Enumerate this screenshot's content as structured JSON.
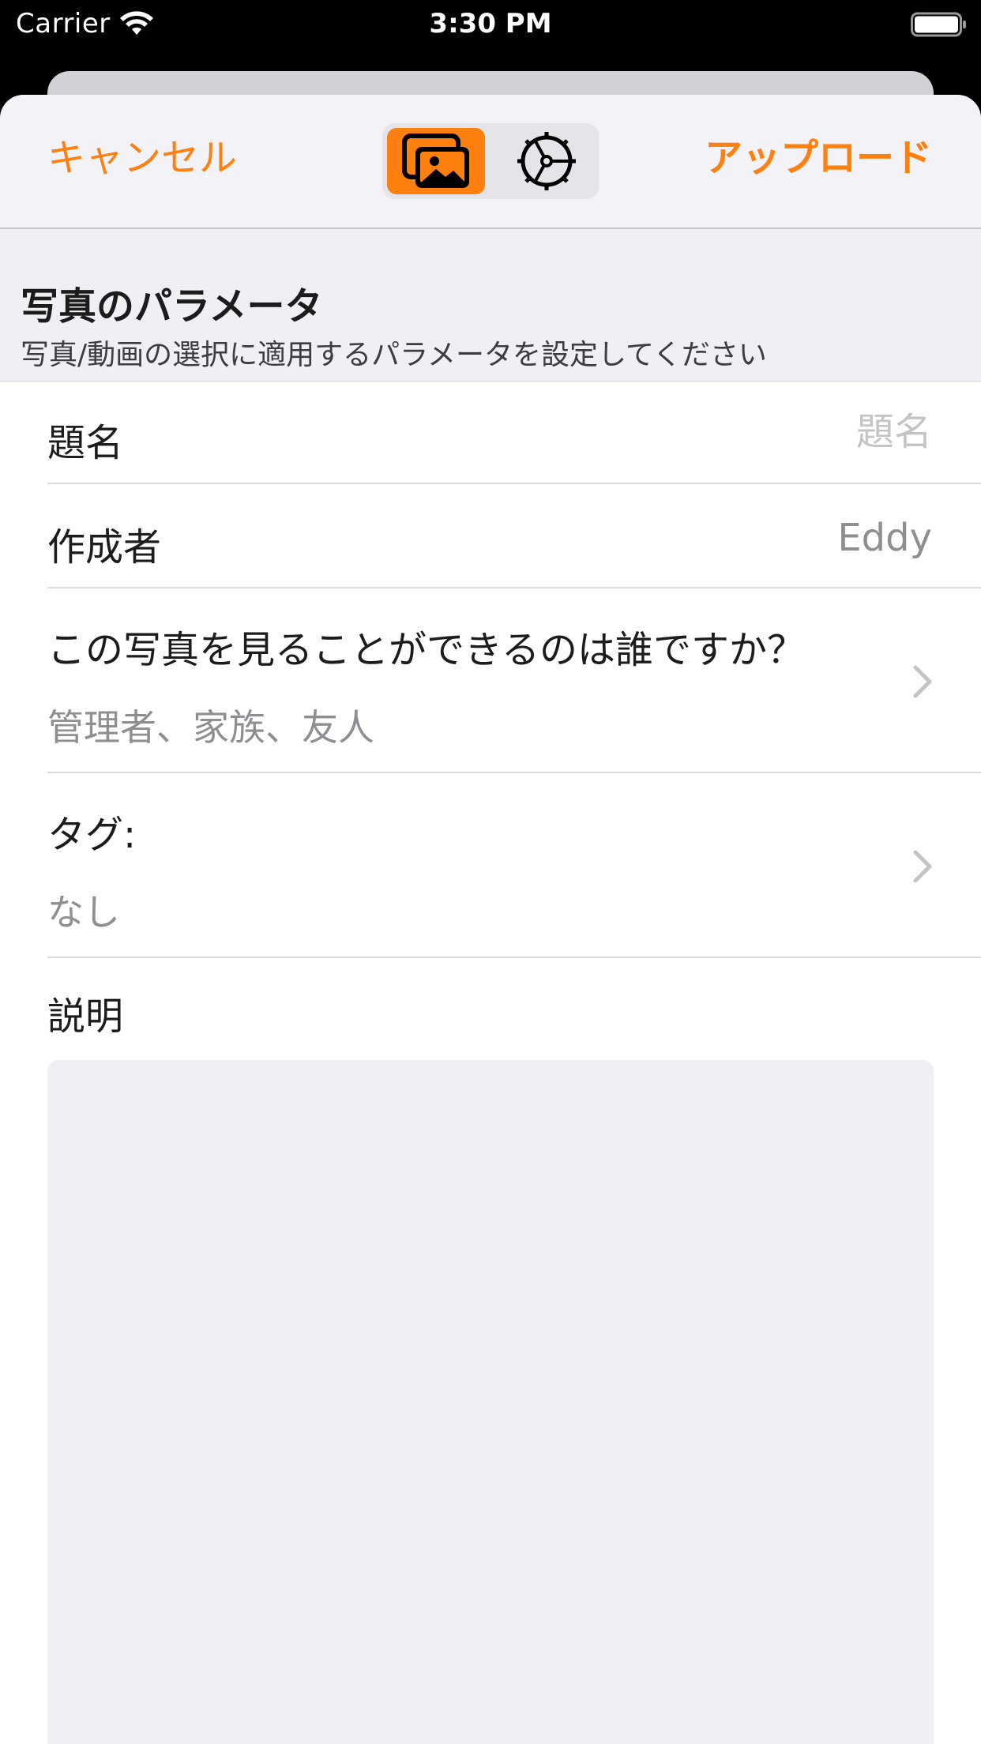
{
  "status_bar": {
    "carrier": "Carrier",
    "time": "3:30 PM"
  },
  "nav": {
    "cancel_label": "キャンセル",
    "upload_label": "アップロード",
    "segments": [
      {
        "icon": "photos-icon",
        "selected": true
      },
      {
        "icon": "settings-icon",
        "selected": false
      }
    ],
    "accent_color": "#ff7f0f"
  },
  "section": {
    "title": "写真のパラメータ",
    "subtitle": "写真/動画の選択に適用するパラメータを設定してください"
  },
  "form": {
    "title_label": "題名",
    "title_placeholder": "題名",
    "author_label": "作成者",
    "author_value": "Eddy",
    "privacy_label": "この写真を見ることができるのは誰ですか？",
    "privacy_value": "管理者、家族、友人",
    "tags_label": "タグ:",
    "tags_value": "なし",
    "description_label": "説明",
    "description_value": ""
  }
}
